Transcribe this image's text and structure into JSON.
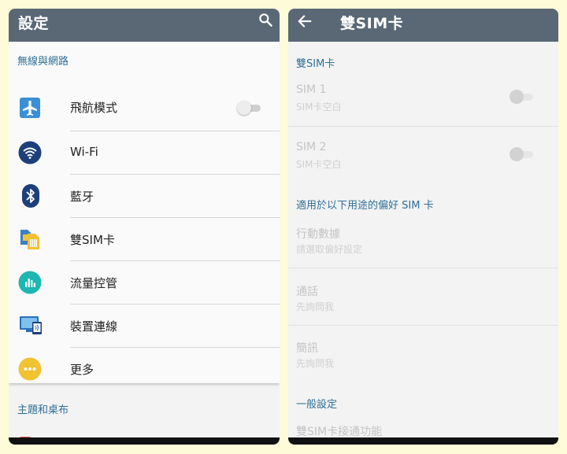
{
  "left": {
    "title": "設定",
    "section1": "無線與網路",
    "items": [
      {
        "label": "飛航模式",
        "icon": "airplane-icon"
      },
      {
        "label": "Wi-Fi",
        "icon": "wifi-icon"
      },
      {
        "label": "藍牙",
        "icon": "bluetooth-icon"
      },
      {
        "label": "雙SIM卡",
        "icon": "dual-sim-icon"
      },
      {
        "label": "流量控管",
        "icon": "data-usage-icon"
      },
      {
        "label": "裝置連線",
        "icon": "device-connection-icon"
      },
      {
        "label": "更多",
        "icon": "more-icon"
      }
    ],
    "section2": "主題和桌布"
  },
  "right": {
    "title": "雙SIM卡",
    "section1": "雙SIM卡",
    "sim1": {
      "title": "SIM 1",
      "sub": "SIM卡空白"
    },
    "sim2": {
      "title": "SIM 2",
      "sub": "SIM卡空白"
    },
    "section2": "適用於以下用途的偏好 SIM 卡",
    "data": {
      "title": "行動數據",
      "sub": "請選取偏好設定"
    },
    "calls": {
      "title": "通話",
      "sub": "先詢問我"
    },
    "sms": {
      "title": "簡訊",
      "sub": "先詢問我"
    },
    "section3": "一般設定",
    "general_item": "雙SIM卡接通功能"
  },
  "colors": {
    "background": "#fdfbd8",
    "appbar": "#5a6875",
    "accent": "#2f6f96"
  }
}
